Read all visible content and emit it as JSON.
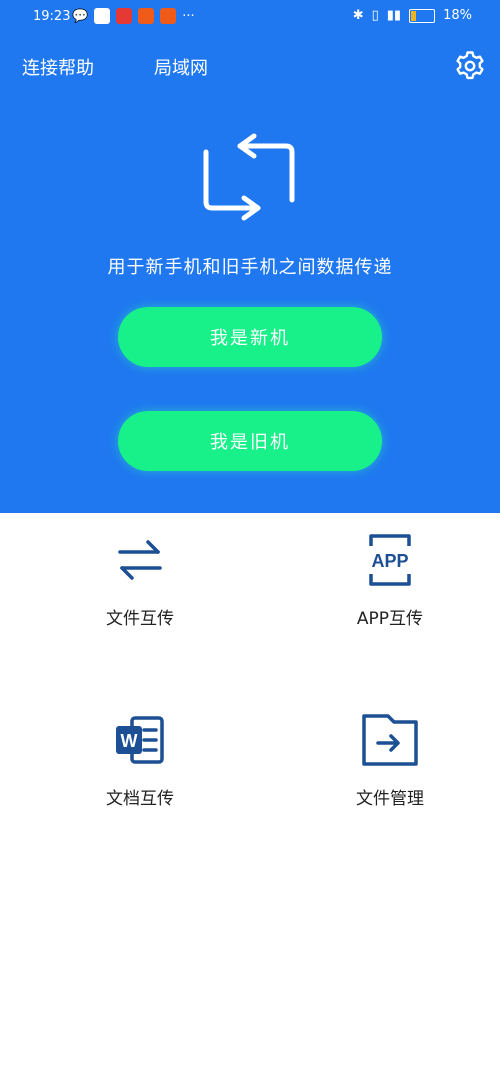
{
  "status_bar": {
    "time": "19:23",
    "battery": "18%"
  },
  "header": {
    "tabs": [
      {
        "label": "连接帮助"
      },
      {
        "label": "局域网"
      }
    ],
    "settings_icon": "gear-icon"
  },
  "hero": {
    "icon": "swap-arrows-icon",
    "tagline": "用于新手机和旧手机之间数据传递"
  },
  "buttons": {
    "new_phone": "我是新机",
    "old_phone": "我是旧机"
  },
  "features": [
    {
      "label": "文件互传",
      "icon": "swap-horizontal-icon"
    },
    {
      "label": "APP互传",
      "icon": "app-icon"
    },
    {
      "label": "文档互传",
      "icon": "word-document-icon"
    },
    {
      "label": "文件管理",
      "icon": "folder-arrow-icon"
    }
  ],
  "colors": {
    "primary": "#1f78f0",
    "button": "#18f08a",
    "icon": "#1c4f93"
  }
}
